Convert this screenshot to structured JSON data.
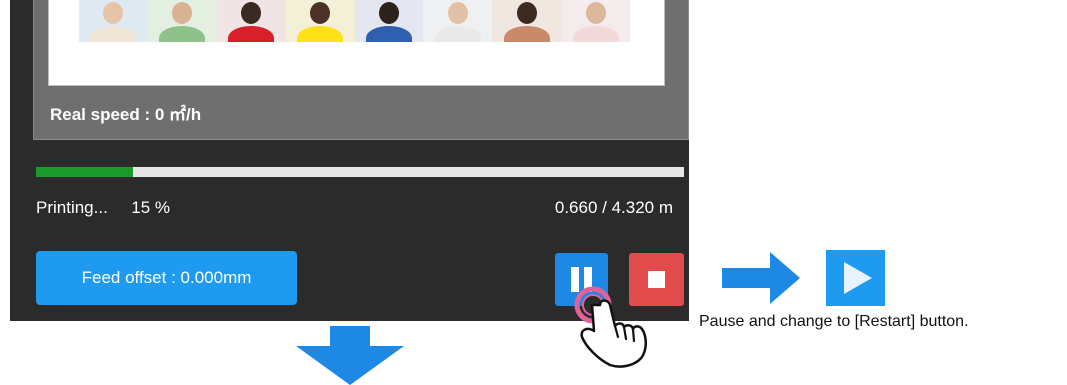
{
  "real_speed": "Real speed : 0 ㎡/h",
  "status": {
    "state": "Printing...",
    "percent": "15 %",
    "progress_fraction": 0.15,
    "length": "0.660 / 4.320 m"
  },
  "buttons": {
    "feed_offset": "Feed offset : 0.000mm",
    "pause": "pause-icon",
    "stop": "stop-icon",
    "restart": "play-icon"
  },
  "annotation": "Pause and change to [Restart] button.",
  "colors": {
    "panel_bg": "#2b2b2b",
    "progress_fill": "#1a9a2a",
    "button_blue": "#1e9bf0",
    "stop_red": "#e24b4b",
    "arrow_blue": "#1e88e5"
  }
}
